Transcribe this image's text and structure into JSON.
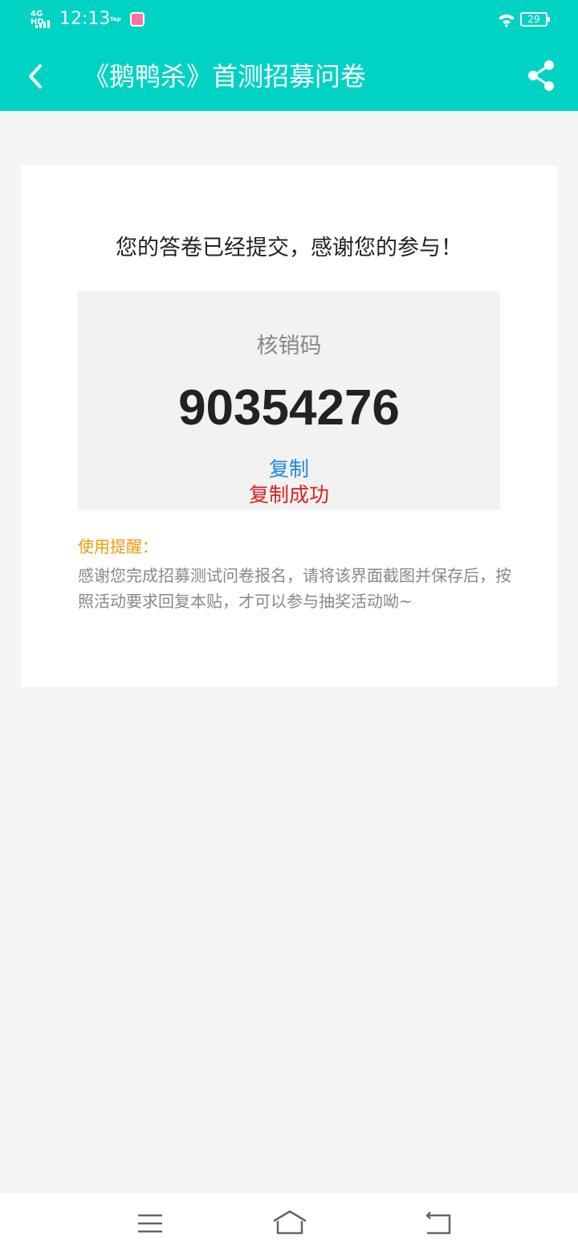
{
  "status_bar": {
    "network": "4G HD",
    "time": "12:13",
    "app_icon_1": "Tap",
    "battery": "29"
  },
  "header": {
    "title": "《鹅鸭杀》首测招募问卷",
    "back_icon": "chevron-left-icon",
    "share_icon": "share-icon",
    "background_color": "#00d3c4"
  },
  "card": {
    "message": "您的答卷已经提交，感谢您的参与！",
    "code_label": "核销码",
    "code_value": "90354276",
    "copy_label": "复制",
    "copy_success": "复制成功",
    "reminder_title": "使用提醒：",
    "reminder_text": "感谢您完成招募测试问卷报名，请将该界面截图并保存后，按照活动要求回复本贴，才可以参与抽奖活动呦~"
  },
  "colors": {
    "accent": "#00d3c4",
    "link": "#1e88e5",
    "success": "#e02020",
    "warning": "#f09a0a"
  },
  "bottom_nav": {
    "menu_icon": "menu-icon",
    "home_icon": "home-icon",
    "back_icon": "back-icon"
  }
}
